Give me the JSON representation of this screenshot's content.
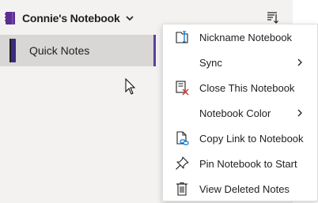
{
  "notebook": {
    "title": "Connie's Notebook",
    "book_icon": "notebook-icon",
    "sort_icon": "sort-icon",
    "accent": "#5b2d91"
  },
  "sections": [
    {
      "label": "Quick Notes",
      "color": "#3b2a80"
    }
  ],
  "context_menu": {
    "items": [
      {
        "label": "Nickname Notebook",
        "icon": "nickname-icon",
        "submenu": false
      },
      {
        "label": "Sync",
        "icon": "",
        "submenu": true
      },
      {
        "label": "Close This Notebook",
        "icon": "close-notebook-icon",
        "submenu": false
      },
      {
        "label": "Notebook Color",
        "icon": "",
        "submenu": true
      },
      {
        "label": "Copy Link to Notebook",
        "icon": "copy-link-icon",
        "submenu": false
      },
      {
        "label": "Pin Notebook to Start",
        "icon": "pin-icon",
        "submenu": false
      },
      {
        "label": "View Deleted Notes",
        "icon": "trash-icon",
        "submenu": false
      }
    ]
  }
}
